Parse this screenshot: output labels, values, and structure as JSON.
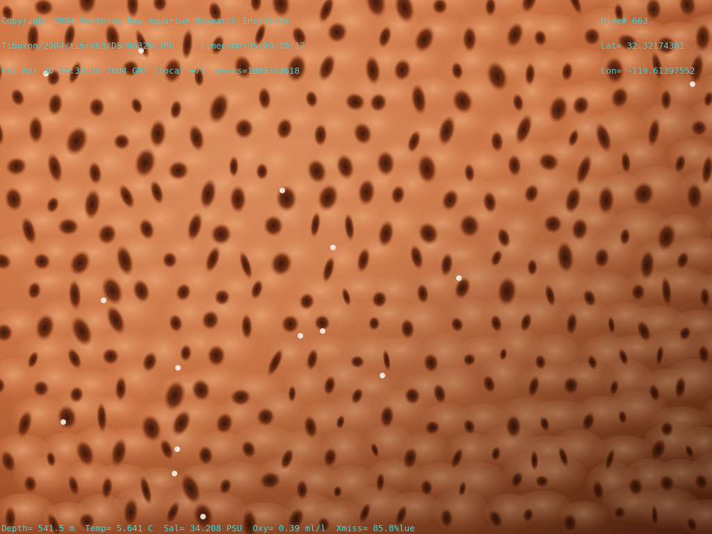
{
  "overlay": {
    "top_left": {
      "line1": "Copyright 2004 Monterey Bay Aquarium Research Institute",
      "line2": "Tiburon/2004/tibr663/DSCN6329.JPG     timecode=05:09:10:17",
      "line3": "Fri Apr 30 19:33:38 2004 GMT (local +7)  esecs=1083353618"
    },
    "top_right": {
      "dive": "Dive# 663",
      "lat": "Lat= 32.32174301",
      "lon": "Lon= -119.61397552"
    },
    "bottom": {
      "depth": "Depth= 541.5 m",
      "temp": "Temp= 5.641 C",
      "sal": "Sal= 34.208 PSU",
      "oxy": "Oxy= 0.39 ml/l",
      "xmiss": "Xmiss= 85.8%lue"
    }
  },
  "scene": {
    "subject": "orange sponge surface with pores",
    "colors": {
      "base": "#b55a2c",
      "ridge": "#e79a6a",
      "pore": "#5a2410",
      "speck": "#f5f1ea",
      "text": "#3fe0e6"
    }
  }
}
